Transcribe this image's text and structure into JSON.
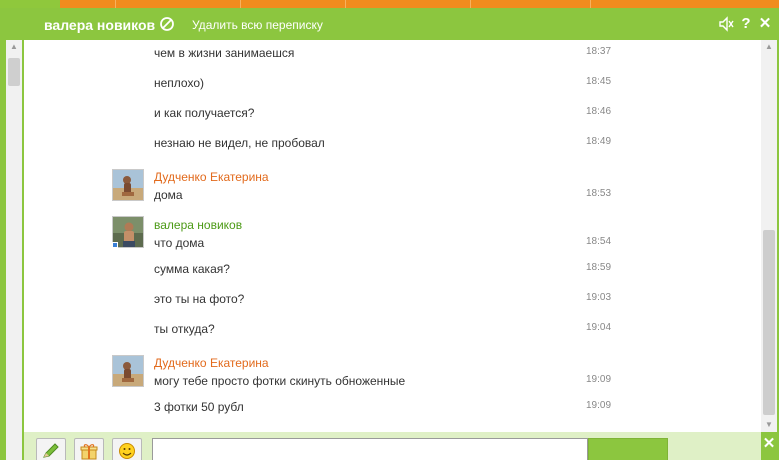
{
  "header": {
    "contact_name": "валера новиков",
    "delete_all_label": "Удалить всю переписку",
    "sound_icon": "speaker-muted-icon",
    "help_label": "?",
    "close_label": "✕"
  },
  "messages": [
    {
      "text": "чем в жизни занимаешся",
      "time": "18:37"
    },
    {
      "text": "неплохо)",
      "time": "18:45"
    },
    {
      "text": "и как получается?",
      "time": "18:46"
    },
    {
      "text": "незнаю не видел, не пробовал",
      "time": "18:49"
    },
    {
      "author": "Дудченко Екатерина",
      "text": "дома",
      "time": "18:53"
    },
    {
      "author": "валера новиков",
      "text": "что дома",
      "time": "18:54"
    },
    {
      "text": "сумма какая?",
      "time": "18:59"
    },
    {
      "text": "это ты на фото?",
      "time": "19:03"
    },
    {
      "text": "ты откуда?",
      "time": "19:04"
    },
    {
      "author": "Дудченко Екатерина",
      "text": "могу тебе просто фотки скинуть обноженные",
      "time": "19:09"
    },
    {
      "text": "3 фотки 50 рубл",
      "time": "19:09"
    }
  ],
  "bottom": {
    "close_label": "✕",
    "tools": [
      "pencil-icon",
      "gift-icon",
      "smiley-icon"
    ]
  },
  "colors": {
    "accent_green": "#8cc63f",
    "author_orange": "#e26a1c",
    "author_green": "#4c9a16",
    "top_orange": "#f08c1e"
  }
}
